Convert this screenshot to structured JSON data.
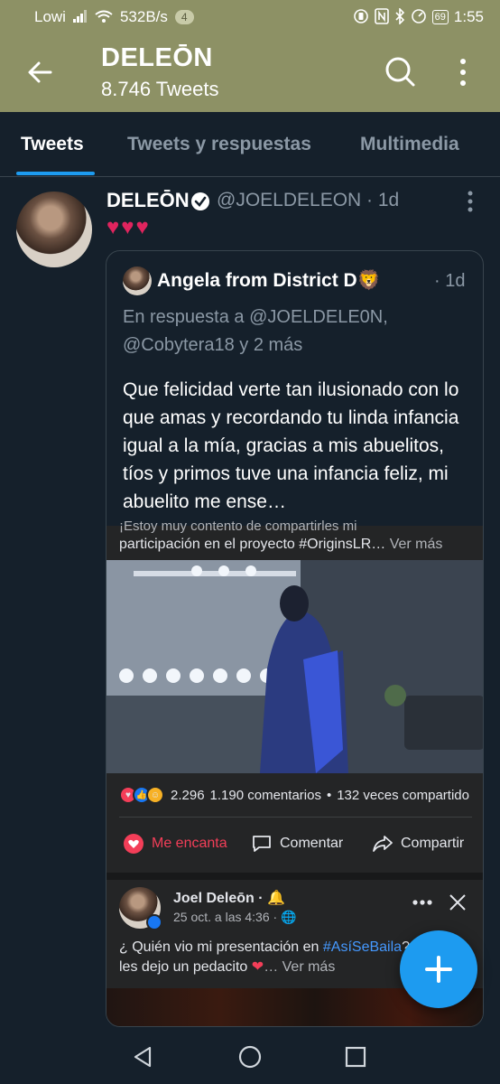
{
  "status_bar": {
    "carrier": "Lowi",
    "net_speed": "532B/s",
    "notif_count": "4",
    "battery": "69",
    "time": "1:55"
  },
  "header": {
    "title": "DELEŌN",
    "subtitle": "8.746 Tweets"
  },
  "tabs": [
    {
      "label": "Tweets",
      "active": true
    },
    {
      "label": "Tweets y respuestas",
      "active": false
    },
    {
      "label": "Multimedia",
      "active": false
    }
  ],
  "tweet": {
    "name": "DELEŌN",
    "handle": "@JOELDELEON · 1d",
    "hearts": "♥♥♥",
    "quote": {
      "name": "Angela from District D🦁",
      "time": "· 1d",
      "reply_to": "En respuesta a @JOELDELE0N, @Cobytera18 y 2 más",
      "text": "Que felicidad verte tan ilusionado con lo que amas y recordando tu linda infancia igual a la mía, gracias a mis abuelitos, tíos y primos tuve una infancia feliz, mi abuelito me ense…",
      "fb": {
        "cut_line": "¡Estoy muy contento de compartirles mi",
        "line": "participación en el proyecto #OriginsLR…",
        "ver_mas": "Ver más",
        "reactions": "2.296",
        "comments": "1.190 comentarios",
        "shares": "132 veces compartido",
        "action_love": "Me encanta",
        "action_comment": "Comentar",
        "action_share": "Compartir",
        "post_author": "Joel Deleōn ·",
        "post_date": "25 oct. a las 4:36 ·",
        "post_text_a": "¿ Quién vio mi presentación en ",
        "post_tag": "#AsíSeBaila",
        "post_text_b": "?",
        "post_text_c": "les dejo un pedacito ",
        "post_heart": "❤",
        "post_more": "… Ver más"
      }
    }
  },
  "colors": {
    "header_bg": "#8d9165",
    "page_bg": "#15202b",
    "accent": "#1d9bf0",
    "heart": "#e0245e"
  }
}
